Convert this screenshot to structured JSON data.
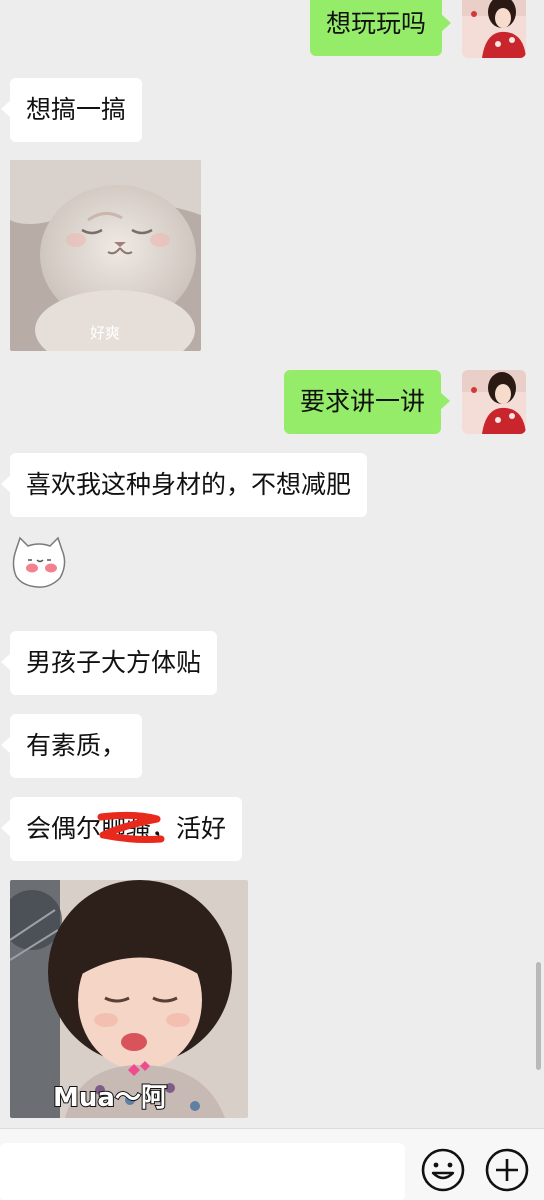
{
  "messages": [
    {
      "from": "me",
      "text": "想玩玩吗"
    },
    {
      "from": "them",
      "text": "想搞一搞"
    },
    {
      "from": "them",
      "sticker": "sleeping-cat",
      "caption": "好爽"
    },
    {
      "from": "me",
      "text": "要求讲一讲"
    },
    {
      "from": "them",
      "text": "喜欢我这种身材的，不想减肥"
    },
    {
      "from": "them",
      "sticker": "blushing-cat-face"
    },
    {
      "from": "them",
      "text": "男孩子大方体贴"
    },
    {
      "from": "them",
      "text": "有素质，"
    },
    {
      "from": "them",
      "text_before": "会偶尔",
      "redacted": "聊骚",
      "text_after": "，活好"
    },
    {
      "from": "them",
      "sticker": "kissing-girl",
      "caption": "Mua～阿"
    }
  ],
  "input_bar": {
    "emoji_icon": "smiley-icon",
    "more_icon": "plus-circle-icon"
  },
  "colors": {
    "background": "#ededed",
    "incoming_bubble": "#ffffff",
    "outgoing_bubble": "#95ec69",
    "redaction": "#e8291c"
  }
}
